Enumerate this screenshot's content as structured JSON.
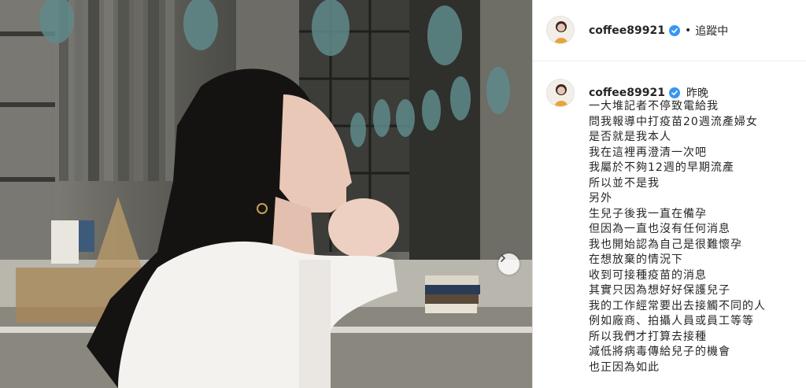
{
  "photo": {
    "description_icon": "photo-image",
    "next_icon": "chevron-right-icon"
  },
  "header": {
    "username": "coffee89921",
    "verified_icon": "verified-badge-icon",
    "separator": "•",
    "follow_label": "追蹤中"
  },
  "caption": {
    "username": "coffee89921",
    "time": "昨晚",
    "lines": [
      "一大堆記者不停致電給我",
      "問我報導中打疫苗20週流產婦女",
      "是否就是我本人",
      "我在這裡再澄清一次吧",
      "我屬於不夠12週的早期流產",
      "所以並不是我",
      "另外",
      "生兒子後我一直在備孕",
      "但因為一直也沒有任何消息",
      "我也開始認為自己是很難懷孕",
      "在想放棄的情況下",
      "收到可接種疫苗的消息",
      "其實只因為想好好保護兒子",
      "我的工作經常要出去接觸不同的人",
      "例如廠商、拍攝人員或員工等等",
      "所以我們才打算去接種",
      "減低將病毒傳給兒子的機會",
      "也正因為如此"
    ]
  },
  "colors": {
    "verified_blue": "#3897f0",
    "text": "#262626",
    "divider": "#dbdbdb"
  }
}
